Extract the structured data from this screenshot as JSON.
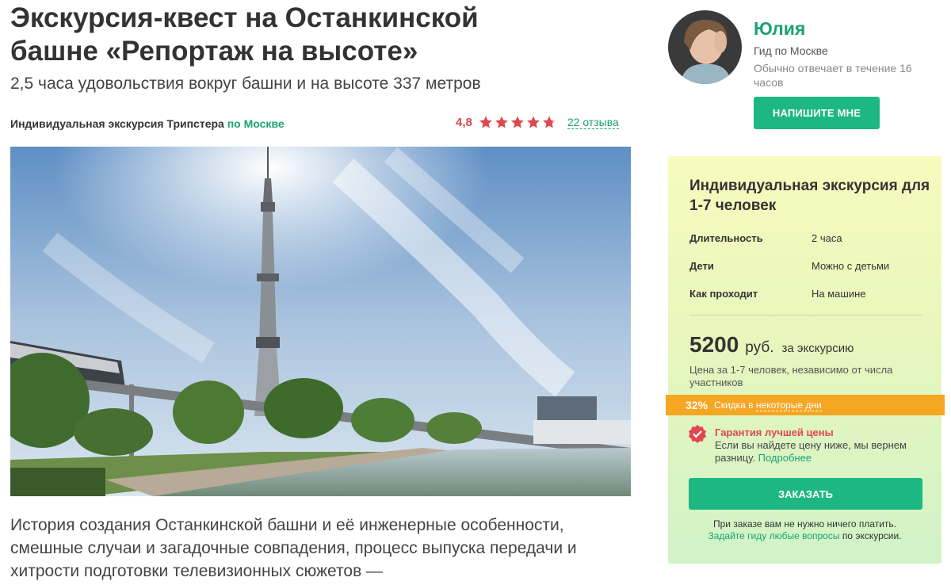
{
  "title": "Экскурсия-квест на Останкинской башне «Репортаж на высоте»",
  "subtitle": "2,5 часа удовольствия вокруг башни и на высоте 337 метров",
  "meta": {
    "type_text": "Индивидуальная экскурсия Трипстера",
    "city_link": "по Москве",
    "rating": "4,8",
    "stars": 5,
    "reviews": "22 отзыва"
  },
  "description": "История создания Останкинской башни и её инженерные особенности, смешные случаи и загадочные совпадения, процесс выпуска передачи и хитрости подготовки телевизионных сюжетов —",
  "guide": {
    "name": "Юлия",
    "role": "Гид по Москве",
    "reply_time": "Обычно отвечает в течение 16 часов",
    "write_button": "НАПИШИТЕ МНЕ"
  },
  "booking": {
    "title": "Индивидуальная экскурсия для 1-7 человек",
    "specs": [
      {
        "label": "Длительность",
        "value": "2 часа"
      },
      {
        "label": "Дети",
        "value": "Можно с детьми"
      },
      {
        "label": "Как проходит",
        "value": "На машине"
      }
    ],
    "price": "5200",
    "currency": "руб.",
    "price_per": "за экскурсию",
    "price_note": "Цена за 1-7 человек, независимо от числа участников",
    "discount_pct": "32%",
    "discount_text_a": "Скидка в ",
    "discount_text_b": "некоторые дни",
    "guarantee_title": "Гарантия лучшей цены",
    "guarantee_text": "Если вы найдете цену ниже, мы вернем разницу.",
    "guarantee_more": "Подробнее",
    "order_button": "ЗАКАЗАТЬ",
    "pay_note_1": "При заказе вам не нужно ничего платить.",
    "pay_note_ask": "Задайте гиду любые вопросы",
    "pay_note_2": "по экскурсии."
  },
  "colors": {
    "accent_green": "#1cb783",
    "link_green": "#1aa376",
    "rating_red": "#e0474f",
    "discount_orange": "#f5a623"
  }
}
